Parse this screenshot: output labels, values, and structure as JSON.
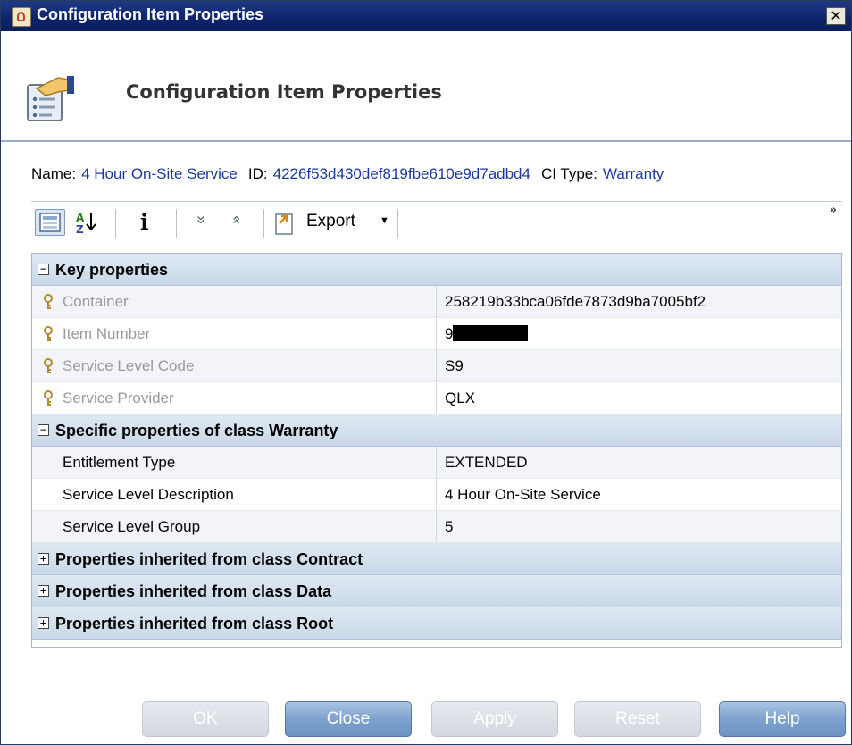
{
  "window": {
    "title": "Configuration Item Properties",
    "close_glyph": "✕"
  },
  "header": {
    "title": "Configuration Item Properties",
    "icon": "properties-document-hand-icon"
  },
  "info": {
    "name_label": "Name:",
    "name_value": "4 Hour On-Site Service",
    "id_label": "ID:",
    "id_value": "4226f53d430def819fbe610e9d7adbd4",
    "citype_label": "CI Type:",
    "citype_value": "Warranty"
  },
  "toolbar": {
    "categorized_icon": "categorized-view-icon",
    "sort_icon": "sort-az-icon",
    "info_glyph": "i",
    "expand_all_glyph": "»",
    "collapse_all_glyph": "«",
    "export_label": "Export",
    "export_dropdown_glyph": "▼",
    "overflow_glyph": "»"
  },
  "sections": {
    "key": {
      "label": "Key properties",
      "toggle": "−",
      "rows": [
        {
          "name": "Container",
          "value": "258219b33bca06fde7873d9ba7005bf2"
        },
        {
          "name": "Item Number",
          "value": "9"
        },
        {
          "name": "Service Level Code",
          "value": "S9"
        },
        {
          "name": "Service Provider",
          "value": "QLX"
        }
      ]
    },
    "specific": {
      "label": "Specific properties of class Warranty",
      "toggle": "−",
      "rows": [
        {
          "name": "Entitlement Type",
          "value": "EXTENDED"
        },
        {
          "name": "Service Level Description",
          "value": "4 Hour On-Site Service"
        },
        {
          "name": "Service Level Group",
          "value": "5"
        }
      ]
    },
    "contract": {
      "label": "Properties inherited from class Contract",
      "toggle": "+"
    },
    "data": {
      "label": "Properties inherited from class Data",
      "toggle": "+"
    },
    "root": {
      "label": "Properties inherited from class Root",
      "toggle": "+"
    }
  },
  "buttons": {
    "ok": "OK",
    "close": "Close",
    "apply": "Apply",
    "reset": "Reset",
    "help": "Help"
  },
  "colors": {
    "titlebar": "#0c246a",
    "link": "#1a3a9c",
    "section_bg": "#c8d8e8",
    "button_enabled": "#7fa3cf",
    "button_disabled": "#d2d8df"
  }
}
